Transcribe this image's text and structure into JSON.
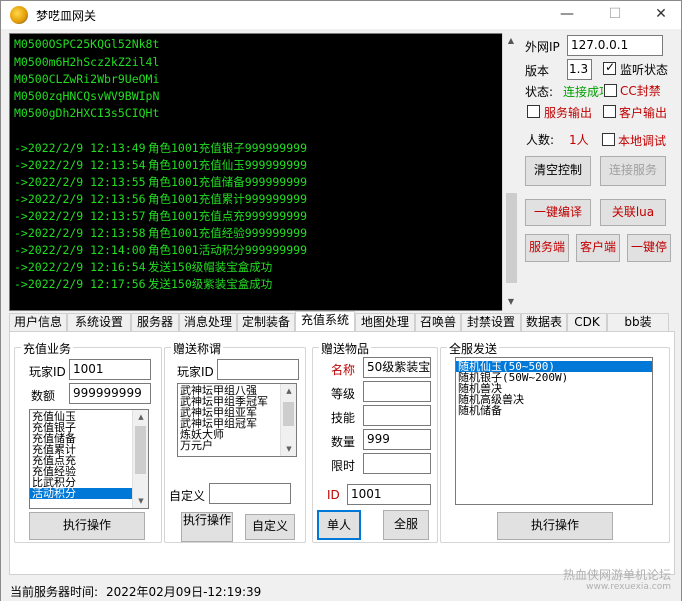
{
  "window": {
    "title": "梦呓皿网关",
    "minimize_glyph": "—",
    "maximize_glyph": "☐",
    "close_glyph": "✕"
  },
  "console": {
    "codes": [
      "M0500OSPC25KQGl52Nk8t",
      "M0500m6H2hScz2kZ2il4l",
      "M0500CLZwRi2Wbr9UeOMi",
      "M0500zqHNCQsvWV9BWIpN",
      "M0500gDh2HXCI3s5CIQHt"
    ],
    "logs": [
      {
        "time": "->2022/2/9 12:13:49",
        "msg": "角色1001充值银子999999999"
      },
      {
        "time": "->2022/2/9 12:13:54",
        "msg": "角色1001充值仙玉999999999"
      },
      {
        "time": "->2022/2/9 12:13:55",
        "msg": "角色1001充值储备999999999"
      },
      {
        "time": "->2022/2/9 12:13:56",
        "msg": "角色1001充值累计999999999"
      },
      {
        "time": "->2022/2/9 12:13:57",
        "msg": "角色1001充值点充999999999"
      },
      {
        "time": "->2022/2/9 12:13:58",
        "msg": "角色1001充值经验999999999"
      },
      {
        "time": "->2022/2/9 12:14:00",
        "msg": "角色1001活动积分999999999"
      },
      {
        "time": "->2022/2/9 12:16:54",
        "msg": "发送150级帽装宝盒成功"
      },
      {
        "time": "->2022/2/9 12:17:56",
        "msg": "发送150级紫装宝盒成功"
      }
    ]
  },
  "side": {
    "ip_label": "外网IP",
    "ip_value": "127.0.0.1",
    "version_label": "版本",
    "version_value": "1.3",
    "monitor_label": "监听状态",
    "status_label": "状态:",
    "status_value": "连接成功",
    "cc_label": "CC封禁",
    "server_out_label": "服务输出",
    "client_out_label": "客户输出",
    "count_label": "人数:",
    "count_value": "1人",
    "local_debug_label": "本地调试",
    "clear_btn": "清空控制",
    "connect_btn": "连接服务",
    "compile_btn": "一键编译",
    "lua_btn": "关联lua",
    "server_btn": "服务端",
    "client_btn": "客户端",
    "stop_btn": "一键停"
  },
  "tabs": [
    "用户信息",
    "系统设置",
    "服务器",
    "消息处理",
    "定制装备",
    "充值系统",
    "地图处理",
    "召唤兽",
    "封禁设置",
    "数据表",
    "CDK",
    "bb装"
  ],
  "recharge": {
    "title": "充值业务",
    "player_id_label": "玩家ID",
    "player_id_value": "1001",
    "amount_label": "数额",
    "amount_value": "999999999",
    "options": [
      "充值仙玉",
      "充值银子",
      "充值储备",
      "充值累计",
      "充值点充",
      "充值经验",
      "比武积分",
      "活动积分"
    ],
    "execute_btn": "执行操作"
  },
  "title_gift": {
    "title": "赠送称谓",
    "player_id_label": "玩家ID",
    "titles": [
      "武神坛甲组八强",
      "武神坛甲组季冠军",
      "武神坛甲组亚军",
      "武神坛甲组冠军",
      "炼妖大师",
      "万元户"
    ],
    "custom_label": "自定义",
    "execute_btn": "执行操作",
    "custom_btn": "自定义"
  },
  "item_gift": {
    "title": "赠送物品",
    "name_label": "名称",
    "name_value": "50级紫装宝盒",
    "level_label": "等级",
    "skill_label": "技能",
    "qty_label": "数量",
    "qty_value": "999",
    "limit_label": "限时",
    "id_label": "ID",
    "id_value": "1001",
    "single_btn": "单人",
    "all_btn": "全服"
  },
  "server_gift": {
    "title": "全服发送",
    "items": [
      "随机仙玉(50~500)",
      "随机银子(50W~200W)",
      "随机兽决",
      "随机高级兽决",
      "随机储备"
    ],
    "execute_btn": "执行操作"
  },
  "statusbar": {
    "label": "当前服务器时间:",
    "value": "2022年02月09日-12:19:39"
  },
  "watermark": {
    "line1": "热血侠网游单机论坛",
    "line2": "www.rexuexia.com"
  }
}
